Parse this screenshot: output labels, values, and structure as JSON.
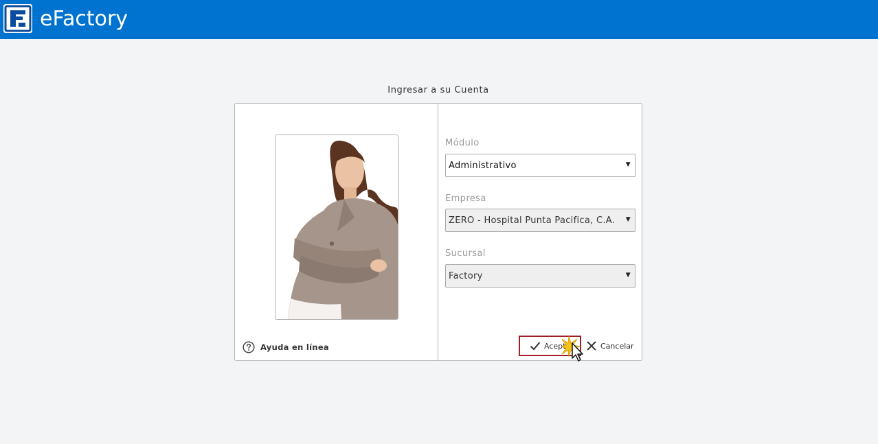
{
  "header": {
    "app_title": "eFactory",
    "logo_icon": "efactory-logo-icon",
    "background_color": "#0072cf"
  },
  "login": {
    "title": "Ingresar a su Cuenta",
    "help_label": "Ayuda en línea",
    "help_icon": "question-circle-icon",
    "fields": {
      "modulo": {
        "label": "Módulo",
        "value": "Administrativo"
      },
      "empresa": {
        "label": "Empresa",
        "value": "ZERO - Hospital Punta Pacifica, C.A."
      },
      "sucursal": {
        "label": "Sucursal",
        "value": "Factory"
      }
    },
    "buttons": {
      "accept": {
        "label": "Aceptar",
        "icon": "checkmark-icon",
        "highlight_color": "#a31d24"
      },
      "cancel": {
        "label": "Cancelar",
        "icon": "x-icon"
      }
    }
  }
}
